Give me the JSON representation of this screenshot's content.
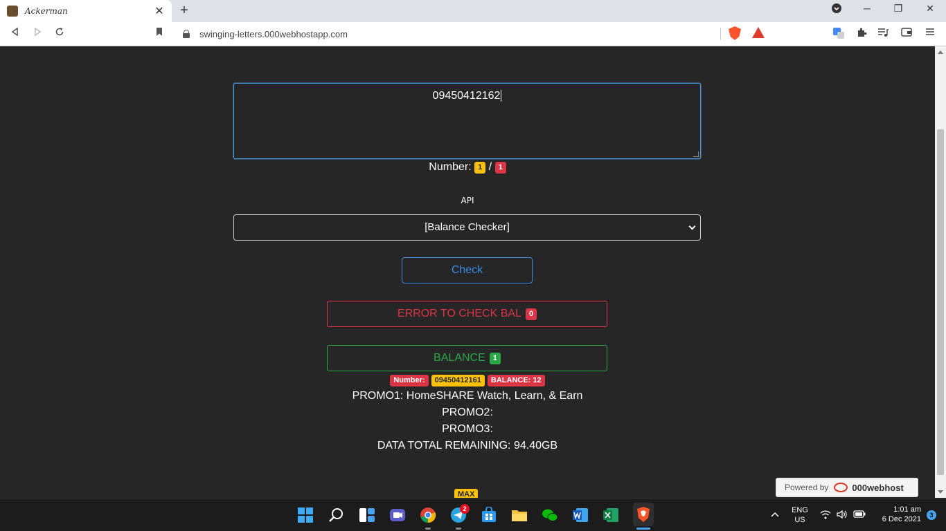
{
  "browser": {
    "tab_title": "Ackerman",
    "tab_close": "✕",
    "new_tab": "+",
    "url": "swinging-letters.000webhostapp.com",
    "window_minimize": "─",
    "window_restore": "❐",
    "window_close": "✕"
  },
  "page": {
    "numbers_input_value": "09450412162",
    "count_label": "Number:",
    "count_current": "1",
    "count_separator": "/",
    "count_total": "1",
    "api_label": "API",
    "api_selected": "[Balance Checker]",
    "check_button": "Check",
    "error_label": "ERROR TO CHECK BAL",
    "error_count": "0",
    "balance_label": "BALANCE",
    "balance_count": "1",
    "result": {
      "number_label": "Number:",
      "number_value": "09450412161",
      "balance_value": "BALANCE: 12"
    },
    "promo1": "PROMO1: HomeSHARE Watch, Learn, & Earn",
    "promo2": "PROMO2:",
    "promo3": "PROMO3:",
    "data_total": "DATA TOTAL REMAINING: 94.40GB",
    "max_badge": "MAX",
    "powered_by": "Powered by",
    "powered_brand": "000webhost"
  },
  "taskbar": {
    "telegram_badge": "2",
    "language": "ENG",
    "region": "US",
    "time": "1:01 am",
    "date": "6 Dec 2021",
    "notifications": "3"
  },
  "colors": {
    "page_bg": "#262626",
    "primary": "#3b8fe5",
    "danger": "#dc3545",
    "success": "#28a745",
    "warning": "#ffc107"
  }
}
